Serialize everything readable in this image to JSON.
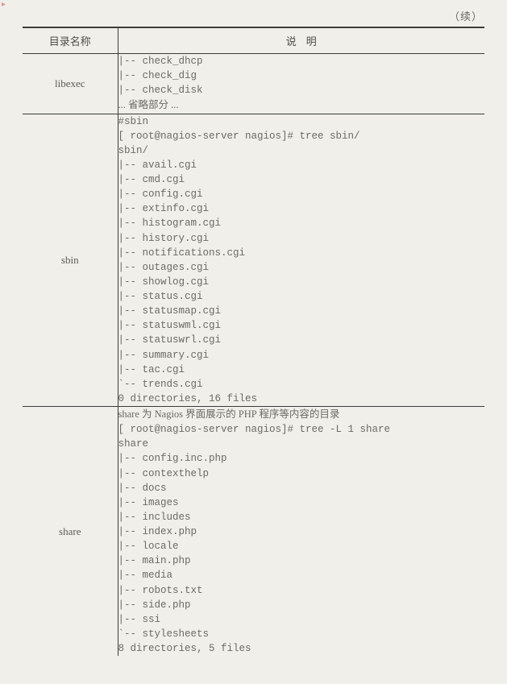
{
  "continued_label": "（续）",
  "headers": {
    "name": "目录名称",
    "desc_a": "说",
    "desc_b": "明"
  },
  "rows": {
    "libexec": {
      "name": "libexec",
      "lines": [
        "|-- check_dhcp",
        "|-- check_dig",
        "|-- check_disk",
        "... 省略部分 ..."
      ]
    },
    "sbin": {
      "name": "sbin",
      "lines": [
        "#sbin",
        "[ root@nagios-server nagios]# tree sbin/",
        "sbin/",
        "|-- avail.cgi",
        "|-- cmd.cgi",
        "|-- config.cgi",
        "|-- extinfo.cgi",
        "|-- histogram.cgi",
        "|-- history.cgi",
        "|-- notifications.cgi",
        "|-- outages.cgi",
        "|-- showlog.cgi",
        "|-- status.cgi",
        "|-- statusmap.cgi",
        "|-- statuswml.cgi",
        "|-- statuswrl.cgi",
        "|-- summary.cgi",
        "|-- tac.cgi",
        "`-- trends.cgi",
        "0 directories, 16 files"
      ]
    },
    "share": {
      "name": "share",
      "intro": "share 为 Nagios 界面展示的 PHP 程序等内容的目录",
      "lines": [
        "[ root@nagios-server nagios]# tree -L 1 share",
        "share",
        "|-- config.inc.php",
        "|-- contexthelp",
        "|-- docs",
        "|-- images",
        "|-- includes",
        "|-- index.php",
        "|-- locale",
        "|-- main.php",
        "|-- media",
        "|-- robots.txt",
        "|-- side.php",
        "|-- ssi",
        "`-- stylesheets",
        "8 directories, 5 files"
      ]
    }
  }
}
